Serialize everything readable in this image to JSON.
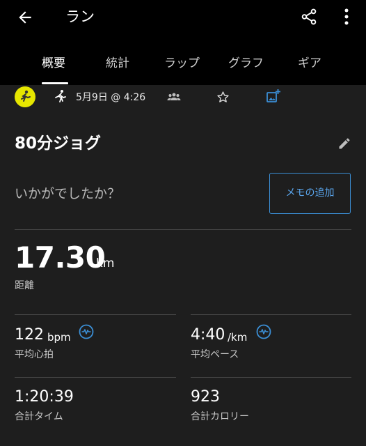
{
  "header": {
    "title": "ラン",
    "back_icon": "arrow-left-icon",
    "share_icon": "share-icon",
    "menu_icon": "more-vertical-icon"
  },
  "tabs": [
    {
      "label": "概要",
      "active": true
    },
    {
      "label": "統計",
      "active": false
    },
    {
      "label": "ラップ",
      "active": false
    },
    {
      "label": "グラフ",
      "active": false
    },
    {
      "label": "ギア",
      "active": false
    }
  ],
  "activity_bar": {
    "date": "5月9日 @ 4:26",
    "activity_color": "#e6e600",
    "icons": [
      "running-activity-icon",
      "runner-icon",
      "group-icon",
      "star-icon",
      "add-photo-icon"
    ]
  },
  "workout": {
    "name": "80分ジョグ",
    "edit_icon": "pencil-icon",
    "prompt": "いかがでしたか？",
    "memo_button": "メモの追加"
  },
  "stats": {
    "distance": {
      "value": "17.30",
      "unit": "km",
      "label": "距離"
    },
    "heart_rate": {
      "value": "122",
      "unit": "bpm",
      "label": "平均心拍",
      "icon": "heart-rate-icon"
    },
    "pace": {
      "value": "4:40",
      "unit": "/km",
      "label": "平均ペース",
      "icon": "heart-rate-icon"
    },
    "time": {
      "value": "1:20:39",
      "label": "合計タイム"
    },
    "calories": {
      "value": "923",
      "label": "合計カロリー"
    }
  },
  "colors": {
    "background": "#1e1e1e",
    "header": "#000000",
    "accent": "#3b8fd6"
  }
}
